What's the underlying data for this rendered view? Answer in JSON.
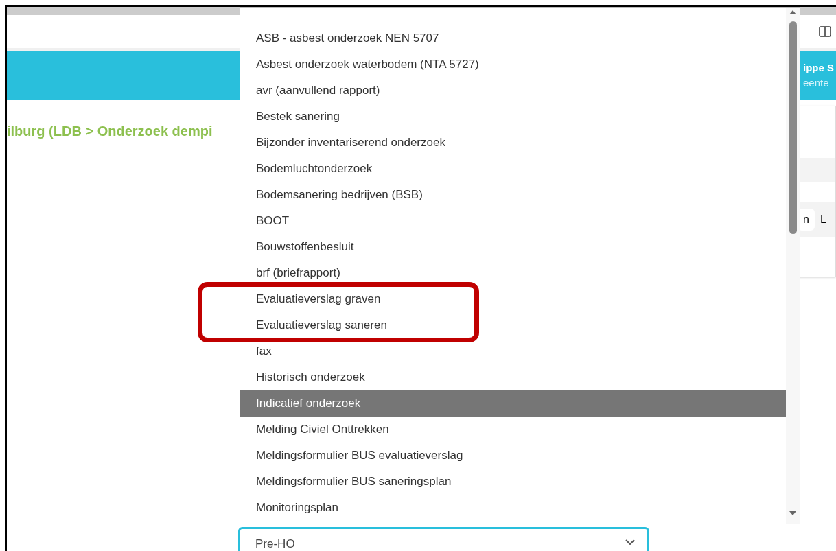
{
  "breadcrumb": "ilburg (LDB > Onderzoek dempi",
  "header_user": {
    "name": "ippe S",
    "role": "eente"
  },
  "right_tabs": [
    {
      "label": "n",
      "selected": true
    },
    {
      "label": "L",
      "selected": false
    }
  ],
  "dropdown": {
    "options": [
      {
        "label": "ASB - asbest onderzoek NEN 5707",
        "selected": false
      },
      {
        "label": "Asbest onderzoek waterbodem (NTA 5727)",
        "selected": false
      },
      {
        "label": "avr (aanvullend rapport)",
        "selected": false
      },
      {
        "label": "Bestek sanering",
        "selected": false
      },
      {
        "label": "Bijzonder inventariserend onderzoek",
        "selected": false
      },
      {
        "label": "Bodemluchtonderzoek",
        "selected": false
      },
      {
        "label": "Bodemsanering bedrijven (BSB)",
        "selected": false
      },
      {
        "label": "BOOT",
        "selected": false
      },
      {
        "label": "Bouwstoffenbesluit",
        "selected": false
      },
      {
        "label": "brf (briefrapport)",
        "selected": false
      },
      {
        "label": "Evaluatieverslag graven",
        "selected": false
      },
      {
        "label": "Evaluatieverslag saneren",
        "selected": false
      },
      {
        "label": "fax",
        "selected": false
      },
      {
        "label": "Historisch onderzoek",
        "selected": false
      },
      {
        "label": "Indicatief onderzoek",
        "selected": true
      },
      {
        "label": "Melding Civiel Onttrekken",
        "selected": false
      },
      {
        "label": "Meldingsformulier BUS evaluatieverslag",
        "selected": false
      },
      {
        "label": "Meldingsformulier BUS saneringsplan",
        "selected": false
      },
      {
        "label": "Monitoringsplan",
        "selected": false
      }
    ]
  },
  "select": {
    "value": "Pre-HO"
  }
}
